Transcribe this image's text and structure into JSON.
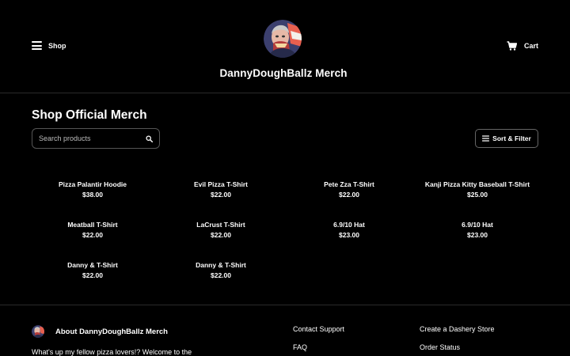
{
  "header": {
    "shop_label": "Shop",
    "store_title": "DannyDoughBallz Merch",
    "cart_label": "Cart"
  },
  "main": {
    "section_title": "Shop Official Merch",
    "search": {
      "placeholder": "Search products",
      "value": ""
    },
    "sort_filter_label": "Sort & Filter",
    "products": [
      {
        "name": "Pizza Palantir Hoodie",
        "price": "$38.00"
      },
      {
        "name": "Evil Pizza T-Shirt",
        "price": "$22.00"
      },
      {
        "name": "Pete Zza T-Shirt",
        "price": "$22.00"
      },
      {
        "name": "Kanji Pizza Kitty Baseball T-Shirt",
        "price": "$25.00"
      },
      {
        "name": "Meatball T-Shirt",
        "price": "$22.00"
      },
      {
        "name": "LaCrust T-Shirt",
        "price": "$22.00"
      },
      {
        "name": "6.9/10 Hat",
        "price": "$23.00"
      },
      {
        "name": "6.9/10 Hat",
        "price": "$23.00"
      },
      {
        "name": "Danny & T-Shirt",
        "price": "$22.00"
      },
      {
        "name": "Danny & T-Shirt",
        "price": "$22.00"
      }
    ]
  },
  "footer": {
    "about_title": "About DannyDoughBallz Merch",
    "about_text": "What's up my fellow pizza lovers!? Welcome to the",
    "links": {
      "contact_support": "Contact Support",
      "faq": "FAQ",
      "create_store": "Create a Dashery Store",
      "order_status": "Order Status"
    }
  },
  "colors": {
    "background": "#000000",
    "text": "#ffffff",
    "border": "#555555",
    "avatar_background": "#e8604f"
  },
  "icons": [
    "hamburger-icon",
    "cart-icon",
    "search-icon",
    "filter-icon",
    "avatar-image"
  ]
}
